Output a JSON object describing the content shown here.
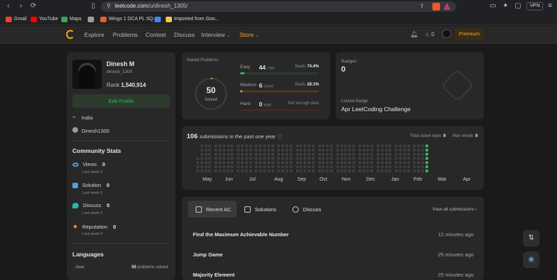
{
  "browser": {
    "url_domain": "leetcode.com",
    "url_path": "/u/dinesh_1305/",
    "vpn_label": "VPN",
    "bookmarks": [
      {
        "label": "Gmail",
        "icon": "gmail-icon",
        "color": "#ea4335"
      },
      {
        "label": "YouTube",
        "icon": "youtube-icon",
        "color": "#ff0000"
      },
      {
        "label": "Maps",
        "icon": "maps-icon",
        "color": "#34a853"
      },
      {
        "label": "",
        "icon": "generic-site-icon",
        "color": "#9e9e9e"
      },
      {
        "label": "Wings 1 DCA PL SQ...",
        "icon": "site-icon",
        "color": "#e85d2a"
      },
      {
        "label": "",
        "icon": "blue-site-icon",
        "color": "#4285f4"
      },
      {
        "label": "Imported from Goo...",
        "icon": "folder-icon",
        "color": "#f2c94c"
      }
    ]
  },
  "nav": {
    "items": [
      "Explore",
      "Problems",
      "Contest",
      "Discuss",
      "Interview",
      "Store"
    ],
    "streak_count": "0",
    "premium_label": "Premium",
    "accent": "#ffa116"
  },
  "profile": {
    "name": "Dinesh M",
    "username": "dinesh_1305",
    "rank_label": "Rank",
    "rank_value": "1,540,914",
    "edit_label": "Edit Profile",
    "location": "India",
    "github": "Dinesh1305"
  },
  "community": {
    "title": "Community Stats",
    "stats": [
      {
        "label": "Views",
        "value": "0",
        "sub": "Last week 0",
        "icon": "eye-icon",
        "color": "#4d9fe8"
      },
      {
        "label": "Solution",
        "value": "0",
        "sub": "Last week 0",
        "icon": "checkbox-icon",
        "color": "#4d9fe8"
      },
      {
        "label": "Discuss",
        "value": "0",
        "sub": "Last week 0",
        "icon": "chat-icon",
        "color": "#2ab7a9"
      },
      {
        "label": "Reputation",
        "value": "0",
        "sub": "Last week 0",
        "icon": "star-icon",
        "color": "#ffa116"
      }
    ]
  },
  "languages": {
    "title": "Languages",
    "items": [
      {
        "name": "Java",
        "count": "50",
        "suffix": "problems solved"
      }
    ]
  },
  "solved": {
    "title": "Solved Problems",
    "total": "50",
    "total_label": "Solved",
    "fraction_of_ring": 0.017,
    "rows": [
      {
        "label": "Easy",
        "count": "44",
        "denom": "/790",
        "beats_label": "Beats",
        "beats": "74.4%",
        "fill": 0.056,
        "color": "#2cbb5d",
        "track": "#2a3c2d"
      },
      {
        "label": "Medium",
        "count": "6",
        "denom": "/1640",
        "beats_label": "Beats",
        "beats": "28.1%",
        "fill": 0.004,
        "color": "#ffa116",
        "track": "#4a3b1e"
      },
      {
        "label": "Hard",
        "count": "0",
        "denom": "/698",
        "beats_label": "",
        "beats": "Not enough data",
        "fill": 0,
        "color": "#ef4743",
        "track": "#4a2424"
      }
    ]
  },
  "badges": {
    "title": "Badges",
    "count": "0",
    "locked_label": "Locked Badge",
    "locked_name": "Apr LeetCoding Challenge"
  },
  "submissions": {
    "count": "106",
    "label": "submissions in the past one year",
    "active_days_label": "Total active days:",
    "active_days": "8",
    "max_streak_label": "Max streak:",
    "max_streak": "8",
    "months": [
      "May",
      "Jun",
      "Jul",
      "Aug",
      "Sep",
      "Oct",
      "Nov",
      "Dec",
      "Jan",
      "Feb",
      "Mar",
      "Apr"
    ],
    "active_color": "#2cbb5d"
  },
  "recent": {
    "tabs": [
      {
        "label": "Recent AC",
        "icon": "list-icon"
      },
      {
        "label": "Solutions",
        "icon": "check-square-icon"
      },
      {
        "label": "Discuss",
        "icon": "discuss-icon"
      }
    ],
    "view_all": "View all submissions",
    "items": [
      {
        "title": "Find the Maximum Achievable Number",
        "time": "12 minutes ago"
      },
      {
        "title": "Jump Game",
        "time": "25 minutes ago"
      },
      {
        "title": "Majority Element",
        "time": "25 minutes ago"
      }
    ]
  }
}
